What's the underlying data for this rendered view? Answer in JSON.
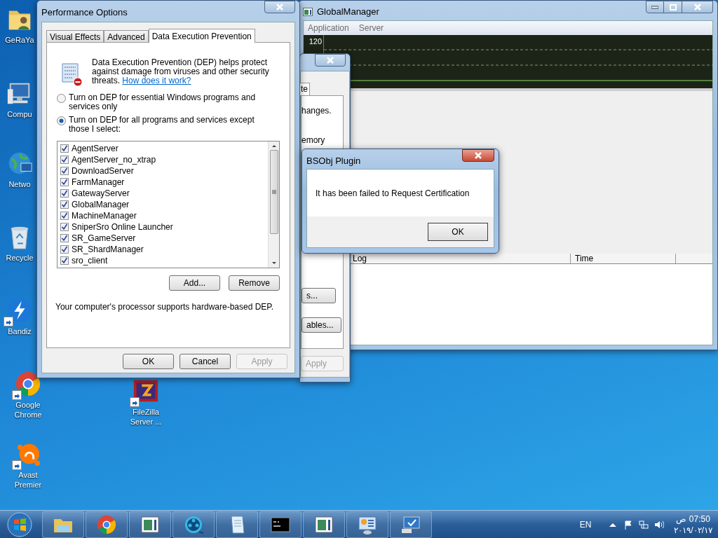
{
  "desktop_icons": [
    {
      "label": "GeRaYa",
      "kind": "user-folder",
      "shortcut": false
    },
    {
      "label": "Compu",
      "kind": "computer",
      "shortcut": false
    },
    {
      "label": "Netwo",
      "kind": "network",
      "shortcut": false
    },
    {
      "label": "Recycle",
      "kind": "recycle-bin",
      "shortcut": false
    },
    {
      "label": "Bandiz",
      "kind": "bolt",
      "shortcut": true
    },
    {
      "label": "Google Chrome",
      "kind": "chrome",
      "shortcut": true
    },
    {
      "label": "Avast Premier",
      "kind": "avast",
      "shortcut": true
    },
    {
      "label": "FileZilla Server ...",
      "kind": "filezilla",
      "shortcut": true
    }
  ],
  "background_window": {
    "tab": "te",
    "texts": [
      "hanges.",
      "emory"
    ],
    "buttons": [
      {
        "label": "s...",
        "disabled": false
      },
      {
        "label": "ables...",
        "disabled": false
      },
      {
        "label": "Apply",
        "disabled": true
      }
    ]
  },
  "performance_options": {
    "title": "Performance Options",
    "tabs": [
      {
        "label": "Visual Effects",
        "selected": false
      },
      {
        "label": "Advanced",
        "selected": false
      },
      {
        "label": "Data Execution Prevention",
        "selected": true
      }
    ],
    "description": "Data Execution Prevention (DEP) helps protect against damage from viruses and other security threats.",
    "link": "How does it work?",
    "options": [
      {
        "label": "Turn on DEP for essential Windows programs and services only",
        "selected": false
      },
      {
        "label": "Turn on DEP for all programs and services except those I select:",
        "selected": true
      }
    ],
    "programs": [
      {
        "label": "AgentServer",
        "checked": true
      },
      {
        "label": "AgentServer_no_xtrap",
        "checked": true
      },
      {
        "label": "DownloadServer",
        "checked": true
      },
      {
        "label": "FarmManager",
        "checked": true
      },
      {
        "label": "GatewayServer",
        "checked": true
      },
      {
        "label": "GlobalManager",
        "checked": true
      },
      {
        "label": "MachineManager",
        "checked": true
      },
      {
        "label": "SniperSro Online Launcher",
        "checked": true
      },
      {
        "label": "SR_GameServer",
        "checked": true
      },
      {
        "label": "SR_ShardManager",
        "checked": true
      },
      {
        "label": "sro_client",
        "checked": true
      }
    ],
    "list_buttons": [
      "Add...",
      "Remove"
    ],
    "support_text": "Your computer's processor supports hardware-based DEP.",
    "buttons": [
      {
        "label": "OK",
        "disabled": false
      },
      {
        "label": "Cancel",
        "disabled": false
      },
      {
        "label": "Apply",
        "disabled": true
      }
    ]
  },
  "global_manager": {
    "title": "GlobalManager",
    "menu": [
      "Application",
      "Server"
    ],
    "graph_label": "120",
    "log_columns": [
      "Log",
      "Time"
    ]
  },
  "message_box": {
    "title": "BSObj Plugin",
    "message": "It has been failed to Request Certification",
    "button": "OK"
  },
  "taskbar": {
    "apps": [
      {
        "kind": "explorer"
      },
      {
        "kind": "chrome"
      },
      {
        "kind": "app-window"
      },
      {
        "kind": "media"
      },
      {
        "kind": "notepad"
      },
      {
        "kind": "console"
      },
      {
        "kind": "app-window"
      },
      {
        "kind": "control-panel"
      },
      {
        "kind": "remote-desktop"
      }
    ],
    "language": "EN",
    "time": "07:50 ص",
    "date": "٢٠١٩/٠٢/١٧"
  }
}
